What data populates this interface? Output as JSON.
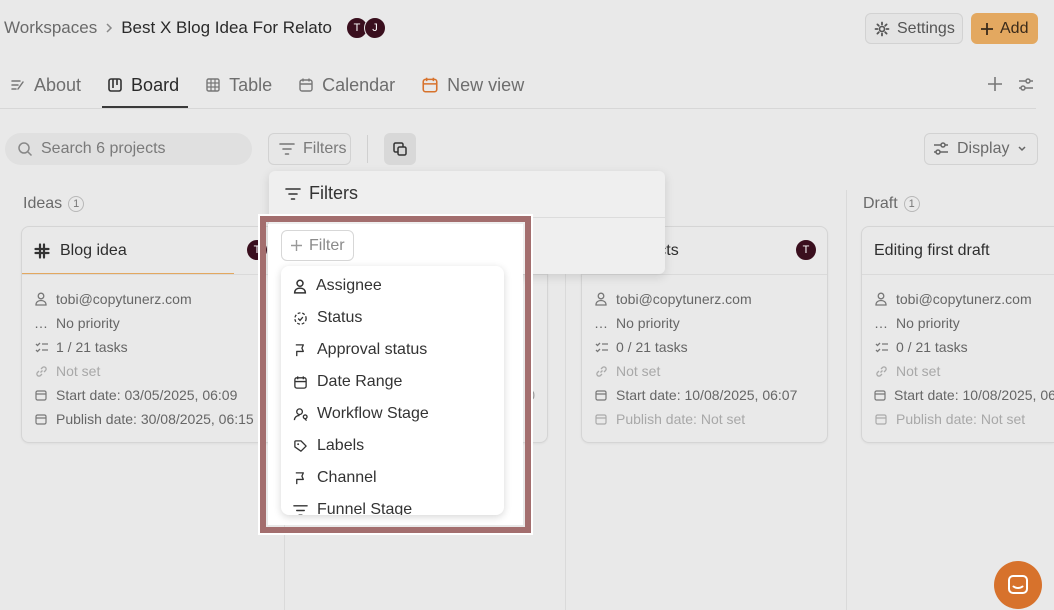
{
  "header": {
    "breadcrumb_root": "Workspaces",
    "breadcrumb_current": "Best X Blog Idea For Relato",
    "avatars": [
      "T",
      "J"
    ],
    "settings_label": "Settings",
    "add_label": "Add"
  },
  "tabs": [
    {
      "label": "About",
      "icon": "edit-lines-icon"
    },
    {
      "label": "Board",
      "icon": "board-icon",
      "active": true
    },
    {
      "label": "Table",
      "icon": "table-icon"
    },
    {
      "label": "Calendar",
      "icon": "calendar-icon"
    },
    {
      "label": "New view",
      "icon": "calendar-orange-icon"
    }
  ],
  "toolbar": {
    "search_placeholder": "Search 6 projects",
    "filters_label": "Filters",
    "display_label": "Display"
  },
  "columns": [
    {
      "title": "Ideas",
      "count": "1"
    },
    {
      "title": "Draft",
      "count": "1"
    }
  ],
  "cards": [
    {
      "title": "Blog idea",
      "avatar": "T",
      "assignee": "tobi@copytunerz.com",
      "priority": "No priority",
      "tasks": "1 / 21 tasks",
      "link": "Not set",
      "start_date": "Start date: 03/05/2025, 06:09",
      "publish_date": "Publish date: 30/08/2025, 06:15"
    },
    {
      "title": "ning projects",
      "avatar": "T",
      "assignee": "tobi@copytunerz.com",
      "priority": "No priority",
      "tasks": "0 / 21 tasks",
      "link": "Not set",
      "start_date": "Start date: 10/08/2025, 06:07",
      "publish_date": "Publish date: Not set"
    },
    {
      "title": "Editing first draft",
      "assignee": "tobi@copytunerz.com",
      "priority": "No priority",
      "tasks": "0 / 21 tasks",
      "link": "Not set",
      "start_date": "Start date: 10/08/2025, 06:",
      "publish_date": "Publish date: Not set"
    }
  ],
  "filters_panel": {
    "title": "Filters",
    "add_filter_label": "Filter",
    "options": [
      "Assignee",
      "Status",
      "Approval status",
      "Date Range",
      "Workflow Stage",
      "Labels",
      "Channel",
      "Funnel Stage"
    ]
  },
  "colors": {
    "accent": "#e3a860",
    "avatar": "#3a0f1e",
    "highlight": "#a36e6e",
    "chat": "#d7722c"
  }
}
